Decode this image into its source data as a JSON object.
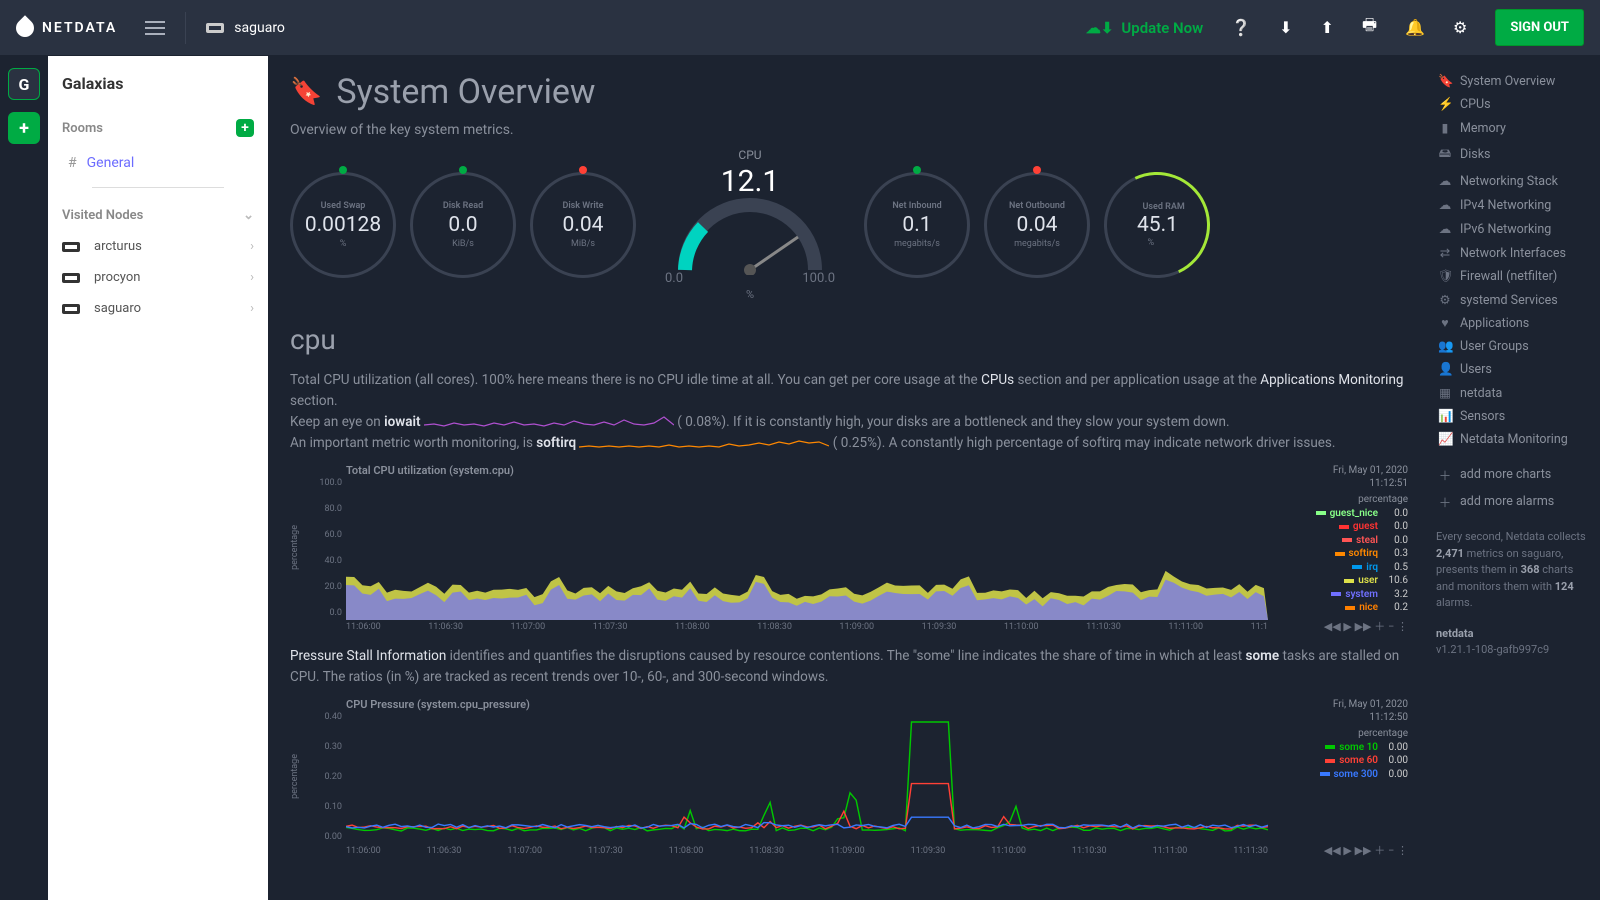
{
  "brand": "NETDATA",
  "current_node": "saguaro",
  "update_label": "Update Now",
  "signout": "SIGN OUT",
  "workspace": "Galaxias",
  "workspace_letter": "G",
  "rooms_header": "Rooms",
  "rooms": [
    {
      "name": "General"
    }
  ],
  "visited_header": "Visited Nodes",
  "visited": [
    "arcturus",
    "procyon",
    "saguaro"
  ],
  "page_title": "System Overview",
  "page_subtitle": "Overview of the key system metrics.",
  "gauges": {
    "swap": {
      "label": "Used Swap",
      "value": "0.00128",
      "unit": "%",
      "dot": "green"
    },
    "diskread": {
      "label": "Disk Read",
      "value": "0.0",
      "unit": "KiB/s",
      "dot": "green"
    },
    "diskwrite": {
      "label": "Disk Write",
      "value": "0.04",
      "unit": "MiB/s",
      "dot": "red"
    },
    "cpu": {
      "label": "CPU",
      "value": "12.1",
      "min": "0.0",
      "max": "100.0",
      "unit": "%"
    },
    "netin": {
      "label": "Net Inbound",
      "value": "0.1",
      "unit": "megabits/s",
      "dot": "green"
    },
    "netout": {
      "label": "Net Outbound",
      "value": "0.04",
      "unit": "megabits/s",
      "dot": "red"
    },
    "ram": {
      "label": "Used RAM",
      "value": "45.1",
      "unit": "%"
    }
  },
  "cpu_section": {
    "heading": "cpu",
    "p1a": "Total CPU utilization (all cores). 100% here means there is no CPU idle time at all. You can get per core usage at the ",
    "p1_link1": "CPUs",
    "p1b": " section and per application usage at the ",
    "p1_link2": "Applications Monitoring",
    "p1c": " section.",
    "p2a": "Keep an eye on ",
    "p2_bold": "iowait",
    "p2_pct": "0.08%",
    "p2b": "). If it is constantly high, your disks are a bottleneck and they slow your system down.",
    "p3a": "An important metric worth monitoring, is ",
    "p3_bold": "softirq",
    "p3_pct": "0.25%",
    "p3b": "). A constantly high percentage of softirq may indicate network driver issues."
  },
  "psi_section": {
    "p1a": "Pressure Stall Information",
    "p1b": " identifies and quantifies the disruptions caused by resource contentions. The \"some\" line indicates the share of time in which at least ",
    "p1_bold": "some",
    "p1c": " tasks are stalled on CPU. The ratios (in %) are tracked as recent trends over 10-, 60-, and 300-second windows."
  },
  "chart_data": [
    {
      "type": "area",
      "title": "Total CPU utilization (system.cpu)",
      "timestamp": "Fri, May 01, 2020",
      "timestamp2": "11:12:51",
      "unit": "percentage",
      "ylim": [
        0,
        100
      ],
      "yticks": [
        "100.0",
        "80.0",
        "60.0",
        "40.0",
        "20.0",
        "0.0"
      ],
      "xticks": [
        "11:06:00",
        "11:06:30",
        "11:07:00",
        "11:07:30",
        "11:08:00",
        "11:08:30",
        "11:09:00",
        "11:09:30",
        "11:10:00",
        "11:10:30",
        "11:11:00",
        "11:1"
      ],
      "series": [
        {
          "name": "guest_nice",
          "color": "#8f8",
          "value": "0.0"
        },
        {
          "name": "guest",
          "color": "#f33",
          "value": "0.0"
        },
        {
          "name": "steal",
          "color": "#f55",
          "value": "0.0"
        },
        {
          "name": "softirq",
          "color": "#f80",
          "value": "0.3"
        },
        {
          "name": "irq",
          "color": "#09e",
          "value": "0.5"
        },
        {
          "name": "user",
          "color": "#dde04a",
          "value": "10.6"
        },
        {
          "name": "system",
          "color": "#7070ff",
          "value": "3.2"
        },
        {
          "name": "nice",
          "color": "#ff8000",
          "value": "0.2"
        }
      ]
    },
    {
      "type": "line",
      "title": "CPU Pressure (system.cpu_pressure)",
      "timestamp": "Fri, May 01, 2020",
      "timestamp2": "11:12:50",
      "unit": "percentage",
      "ylim": [
        0,
        0.4
      ],
      "yticks": [
        "0.40",
        "0.30",
        "0.20",
        "0.10",
        "0.00"
      ],
      "xticks": [
        "11:06:00",
        "11:06:30",
        "11:07:00",
        "11:07:30",
        "11:08:00",
        "11:08:30",
        "11:09:00",
        "11:09:30",
        "11:10:00",
        "11:10:30",
        "11:11:00",
        "11:11:30"
      ],
      "series": [
        {
          "name": "some 10",
          "color": "#00c800",
          "value": "0.00"
        },
        {
          "name": "some 60",
          "color": "#ff4136",
          "value": "0.00"
        },
        {
          "name": "some 300",
          "color": "#3979ff",
          "value": "0.00"
        }
      ]
    }
  ],
  "rightnav": [
    {
      "icon": "🔖",
      "label": "System Overview"
    },
    {
      "icon": "⚡",
      "label": "CPUs"
    },
    {
      "icon": "▮",
      "label": "Memory"
    },
    {
      "icon": "🖴",
      "label": "Disks"
    },
    {
      "icon": "☁",
      "label": "Networking Stack"
    },
    {
      "icon": "☁",
      "label": "IPv4 Networking"
    },
    {
      "icon": "☁",
      "label": "IPv6 Networking"
    },
    {
      "icon": "⇄",
      "label": "Network Interfaces"
    },
    {
      "icon": "🛡",
      "label": "Firewall (netfilter)"
    },
    {
      "icon": "⚙",
      "label": "systemd Services"
    },
    {
      "icon": "♥",
      "label": "Applications"
    },
    {
      "icon": "👥",
      "label": "User Groups"
    },
    {
      "icon": "👤",
      "label": "Users"
    },
    {
      "icon": "▦",
      "label": "netdata"
    },
    {
      "icon": "📊",
      "label": "Sensors"
    },
    {
      "icon": "📈",
      "label": "Netdata Monitoring"
    }
  ],
  "rightnav_actions": [
    {
      "icon": "＋",
      "label": "add more charts"
    },
    {
      "icon": "＋",
      "label": "add more alarms"
    }
  ],
  "stats": {
    "line1a": "Every second, Netdata collects ",
    "metrics": "2,471",
    "line1b": " metrics on saguaro, presents them in ",
    "charts": "368",
    "line1c": " charts and monitors them with ",
    "alarms": "124",
    "line1d": " alarms."
  },
  "version": {
    "name": "netdata",
    "ver": "v1.21.1-108-gafb997c9"
  }
}
